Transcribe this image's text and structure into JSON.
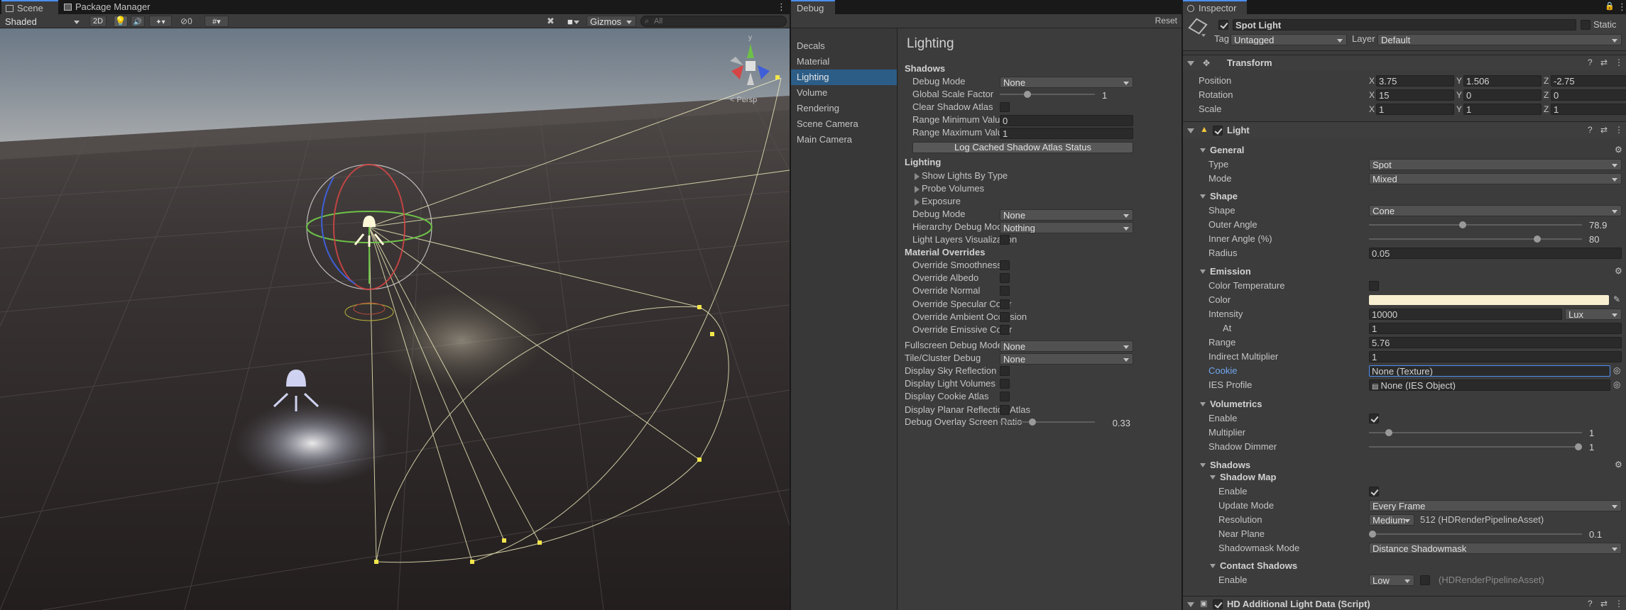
{
  "scene": {
    "tabs": {
      "scene": "Scene",
      "package_manager": "Package Manager"
    },
    "toolbar": {
      "shading": "Shaded",
      "mode_2d": "2D",
      "hidden_count": "0",
      "gizmos": "Gizmos",
      "search_placeholder": "All"
    },
    "persp_label": "< Persp",
    "gizmo_y": "y"
  },
  "debug": {
    "tab": "Debug",
    "reset": "Reset",
    "nav": [
      "Decals",
      "Material",
      "Lighting",
      "Volume",
      "Rendering",
      "Scene Camera",
      "Main Camera"
    ],
    "title": "Lighting",
    "shadows": {
      "header": "Shadows",
      "debug_mode_label": "Debug Mode",
      "debug_mode": "None",
      "global_scale_label": "Global Scale Factor",
      "global_scale": "1",
      "clear_atlas_label": "Clear Shadow Atlas",
      "range_min_label": "Range Minimum Value",
      "range_min": "0",
      "range_max_label": "Range Maximum Value",
      "range_max": "1",
      "log_button": "Log Cached Shadow Atlas Status"
    },
    "lighting": {
      "header": "Lighting",
      "show_lights": "Show Lights By Type",
      "probe_volumes": "Probe Volumes",
      "exposure": "Exposure",
      "debug_mode_label": "Debug Mode",
      "debug_mode": "None",
      "hierarchy_label": "Hierarchy Debug Mode",
      "hierarchy": "Nothing",
      "light_layers_label": "Light Layers Visualization"
    },
    "material_overrides": {
      "header": "Material Overrides",
      "items": [
        "Override Smoothness",
        "Override Albedo",
        "Override Normal",
        "Override Specular Color",
        "Override Ambient Occlusion",
        "Override Emissive Color"
      ]
    },
    "fullscreen_label": "Fullscreen Debug Mode",
    "fullscreen": "None",
    "tile_label": "Tile/Cluster Debug",
    "tile": "None",
    "toggles": [
      "Display Sky Reflection",
      "Display Light Volumes",
      "Display Cookie Atlas",
      "Display Planar Reflection Atlas"
    ],
    "overlay_ratio_label": "Debug Overlay Screen Ratio",
    "overlay_ratio": "0.33",
    "overlay_ratio_fraction": 0.33
  },
  "inspector": {
    "tab": "Inspector",
    "object_name": "Spot Light",
    "static_label": "Static",
    "tag_label": "Tag",
    "tag": "Untagged",
    "layer_label": "Layer",
    "layer": "Default",
    "transform": {
      "header": "Transform",
      "position_label": "Position",
      "position": {
        "x": "3.75",
        "y": "1.506",
        "z": "-2.75"
      },
      "rotation_label": "Rotation",
      "rotation": {
        "x": "15",
        "y": "0",
        "z": "0"
      },
      "scale_label": "Scale",
      "scale": {
        "x": "1",
        "y": "1",
        "z": "1"
      },
      "axis_x": "X",
      "axis_y": "Y",
      "axis_z": "Z"
    },
    "light": {
      "header": "Light",
      "general": {
        "header": "General",
        "type_label": "Type",
        "type": "Spot",
        "mode_label": "Mode",
        "mode": "Mixed"
      },
      "shape": {
        "header": "Shape",
        "shape_label": "Shape",
        "shape": "Cone",
        "outer_angle_label": "Outer Angle",
        "outer_angle": "78.9",
        "outer_angle_level": 0.438,
        "inner_angle_label": "Inner Angle (%)",
        "inner_angle": "80",
        "inner_angle_level": 0.8,
        "radius_label": "Radius",
        "radius": "0.05"
      },
      "emission": {
        "header": "Emission",
        "color_temp_label": "Color Temperature",
        "color_label": "Color",
        "color": "#f7efcf",
        "intensity_label": "Intensity",
        "intensity": "10000",
        "intensity_unit": "Lux",
        "at_label": "At",
        "at": "1",
        "range_label": "Range",
        "range": "5.76",
        "indirect_label": "Indirect Multiplier",
        "indirect": "1",
        "cookie_label": "Cookie",
        "cookie": "None (Texture)",
        "ies_label": "IES Profile",
        "ies": "None (IES Object)"
      },
      "volumetrics": {
        "header": "Volumetrics",
        "enable_label": "Enable",
        "multiplier_label": "Multiplier",
        "multiplier": "1",
        "multiplier_level": 0.08,
        "dimmer_label": "Shadow Dimmer",
        "dimmer": "1",
        "dimmer_level": 1.0
      },
      "shadows": {
        "header": "Shadows",
        "map_header": "Shadow Map",
        "enable_label": "Enable",
        "update_label": "Update Mode",
        "update": "Every Frame",
        "resolution_label": "Resolution",
        "resolution_tier": "Medium",
        "resolution_value": "512 (HDRenderPipelineAsset)",
        "near_label": "Near Plane",
        "near": "0.1",
        "near_level": 0.0,
        "shadowmask_label": "Shadowmask Mode",
        "shadowmask": "Distance Shadowmask",
        "contact_header": "Contact Shadows",
        "contact_enable_label": "Enable",
        "contact_level": "Low",
        "contact_asset": "(HDRenderPipelineAsset)"
      }
    },
    "hd_additional": {
      "header": "HD Additional Light Data (Script)"
    }
  },
  "colors": {
    "accent": "#4d8ff2",
    "selected_nav": "#2c5d87",
    "light_icon": "#f2c53d"
  }
}
